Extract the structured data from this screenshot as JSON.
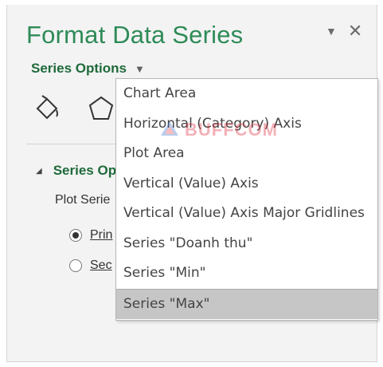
{
  "pane": {
    "title": "Format Data Series",
    "series_options_label": "Series Options",
    "icons": [
      "fill-line-icon",
      "effects-pentagon-icon"
    ],
    "section": {
      "title": "Series Op",
      "plot_series_label": "Plot Serie",
      "radio_primary": "Prin",
      "radio_secondary": "Sec"
    }
  },
  "dropdown": {
    "items": [
      "Chart Area",
      "Horizontal (Category) Axis",
      "Plot Area",
      "Vertical (Value) Axis",
      "Vertical (Value) Axis Major Gridlines",
      "Series \"Doanh thu\"",
      "Series \"Min\"",
      "Series \"Max\""
    ],
    "selected_index": 7
  },
  "watermark": {
    "text": "BUFFCOM"
  },
  "colors": {
    "title_green": "#2e8b57",
    "section_green": "#1f6a3a",
    "selected_bg": "#c6c6c6"
  }
}
